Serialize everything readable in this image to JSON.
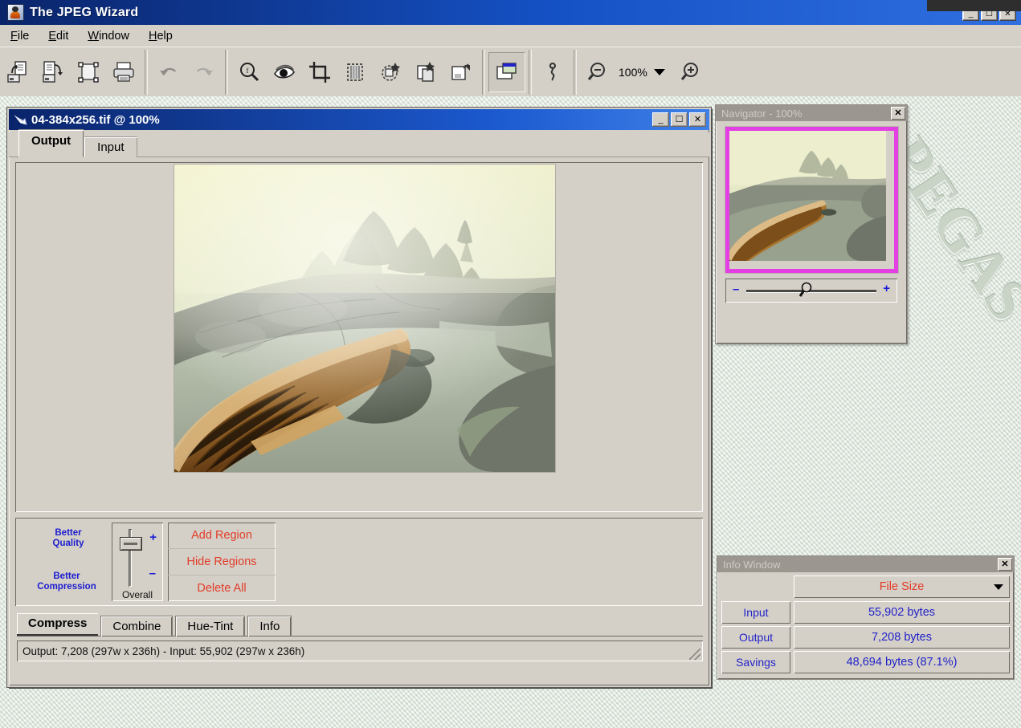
{
  "app": {
    "title": "The JPEG Wizard",
    "icon": "wizard-hat-icon"
  },
  "window_controls": {
    "minimize": "_",
    "maximize": "☐",
    "close": "✕"
  },
  "menu": {
    "items": [
      {
        "label": "File",
        "accel": "F"
      },
      {
        "label": "Edit",
        "accel": "E"
      },
      {
        "label": "Window",
        "accel": "W"
      },
      {
        "label": "Help",
        "accel": "H"
      }
    ]
  },
  "toolbar": {
    "groups": [
      {
        "buttons": [
          {
            "name": "open-file-icon",
            "tip": "Open"
          },
          {
            "name": "save-file-icon",
            "tip": "Save"
          },
          {
            "name": "select-all-icon",
            "tip": "Select"
          },
          {
            "name": "print-icon",
            "tip": "Print"
          }
        ]
      },
      {
        "buttons": [
          {
            "name": "undo-icon",
            "tip": "Undo",
            "disabled": true
          },
          {
            "name": "redo-icon",
            "tip": "Redo",
            "disabled": true
          }
        ]
      },
      {
        "buttons": [
          {
            "name": "magnifier-icon",
            "tip": "Zoom"
          },
          {
            "name": "eye-icon",
            "tip": "Preview"
          },
          {
            "name": "crop-icon",
            "tip": "Crop"
          },
          {
            "name": "grid-mask-icon",
            "tip": "Mask"
          },
          {
            "name": "add-region-icon",
            "tip": "Add Region"
          },
          {
            "name": "copy-region-icon",
            "tip": "Copy Region"
          },
          {
            "name": "paste-region-icon",
            "tip": "Paste Region"
          }
        ]
      },
      {
        "buttons": [
          {
            "name": "navigator-window-icon",
            "tip": "Navigator",
            "pressed": true
          }
        ]
      },
      {
        "buttons": [
          {
            "name": "info-window-icon",
            "tip": "Info Window"
          }
        ]
      },
      {
        "buttons": [
          {
            "name": "zoom-out-icon",
            "tip": "Zoom Out"
          }
        ]
      }
    ],
    "zoom_value": "100%",
    "zoom_in": {
      "name": "zoom-in-icon",
      "tip": "Zoom In"
    }
  },
  "document": {
    "title": "04-384x256.tif @ 100%",
    "tabs": [
      {
        "label": "Output",
        "active": true
      },
      {
        "label": "Input",
        "active": false
      }
    ],
    "image": {
      "alt": "Misty lake scene with wooden canoe beached on granite rock, fog over evergreens"
    },
    "controls": {
      "quality_top_line1": "Better",
      "quality_top_line2": "Quality",
      "quality_bottom_line1": "Better",
      "quality_bottom_line2": "Compression",
      "slider_caption": "Overall",
      "slider_plus": "+",
      "slider_minus": "–",
      "buttons": [
        {
          "label": "Add Region"
        },
        {
          "label": "Hide Regions"
        },
        {
          "label": "Delete All"
        }
      ]
    },
    "bottom_tabs": [
      {
        "label": "Compress",
        "active": true
      },
      {
        "label": "Combine",
        "active": false
      },
      {
        "label": "Hue-Tint",
        "active": false
      },
      {
        "label": "Info",
        "active": false
      }
    ],
    "status": "Output: 7,208 (297w x 236h) - Input: 55,902 (297w x 236h)"
  },
  "navigator": {
    "title": "Navigator - 100%",
    "close": "✕",
    "zoom_minus": "–",
    "zoom_plus": "+"
  },
  "info_window": {
    "title": "Info Window",
    "close": "✕",
    "selector": "File Size",
    "rows": [
      {
        "label": "Input",
        "value": "55,902 bytes"
      },
      {
        "label": "Output",
        "value": "7,208 bytes"
      },
      {
        "label": "Savings",
        "value": "48,694 bytes (87.1%)"
      }
    ]
  },
  "mdi": {
    "watermark": "PEGAS"
  },
  "colors": {
    "face": "#d4d0c8",
    "title_blue": "#0a246a",
    "accent_red": "#e23c28",
    "accent_blue": "#2222c8",
    "region_magenta": "#e43fe4"
  }
}
